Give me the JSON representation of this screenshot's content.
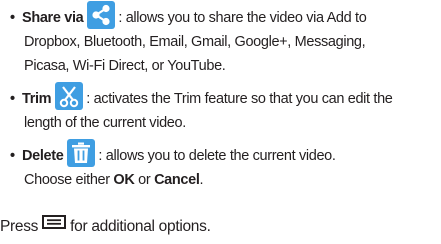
{
  "items": [
    {
      "term": "Share via",
      "icon": "share-icon",
      "lines": [
        ": allows you to share the video via Add to",
        "Dropbox, Bluetooth, Email, Gmail, Google+, Messaging,",
        "Picasa, Wi-Fi Direct, or YouTube."
      ]
    },
    {
      "term": "Trim",
      "icon": "scissors-icon",
      "lines": [
        ": activates the Trim feature so that you can edit the",
        "length of the current video."
      ]
    },
    {
      "term": "Delete",
      "icon": "trash-icon",
      "lines": [
        ": allows you to delete the current video.",
        "Choose either",
        "OK",
        "or",
        "Cancel",
        "."
      ]
    }
  ],
  "bullet": "•",
  "press": {
    "before": "Press",
    "icon": "menu-key-icon",
    "after": "for additional options."
  },
  "colors": {
    "icon_bg": "#3f9ee2",
    "text": "#231f20"
  }
}
